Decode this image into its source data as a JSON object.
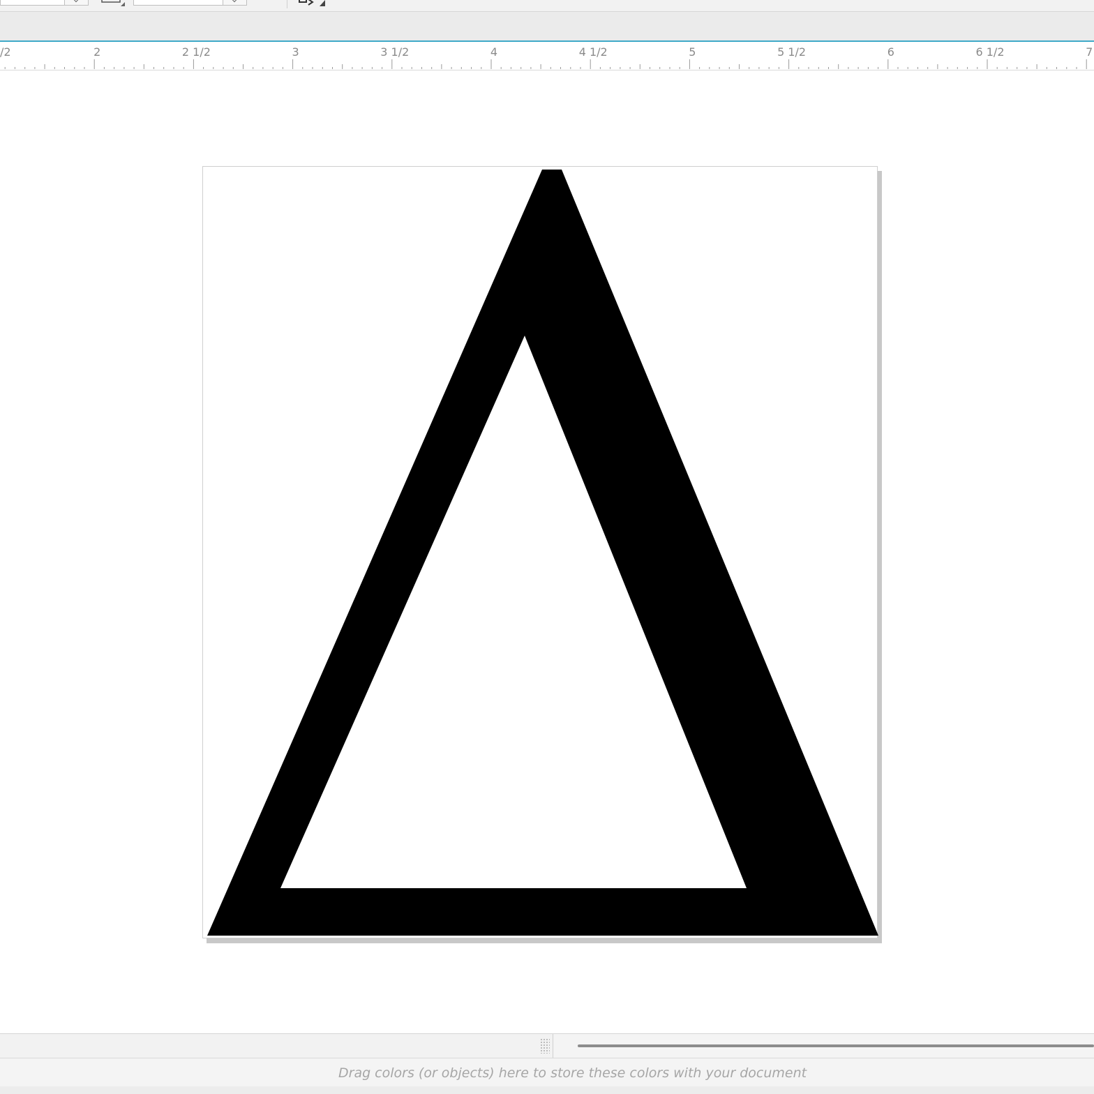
{
  "ruler": {
    "unit_labels": [
      "/2",
      "2",
      "2 1/2",
      "3",
      "3 1/2",
      "4",
      "4 1/2",
      "5",
      "5 1/2",
      "6",
      "6 1/2",
      "7"
    ]
  },
  "canvas": {
    "glyph_icon": "delta-triangle-shape",
    "fill_color": "#000000",
    "page_color": "#ffffff"
  },
  "document_palette": {
    "hint": "Drag colors (or objects) here to store these colors with your document"
  },
  "colors": {
    "accent": "#3fa9c8",
    "chrome": "#f2f2f2",
    "hint_text": "#a6a6a6"
  }
}
